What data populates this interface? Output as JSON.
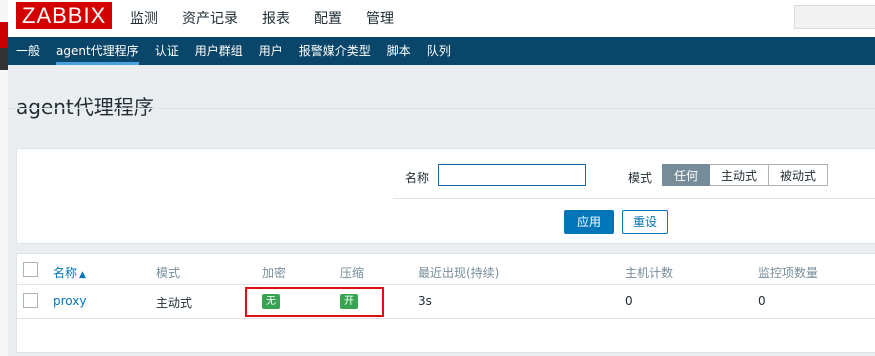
{
  "app": {
    "logo": "ZABBIX"
  },
  "top_menu": [
    "监测",
    "资产记录",
    "报表",
    "配置",
    "管理"
  ],
  "sub_menu": {
    "items": [
      "一般",
      "agent代理程序",
      "认证",
      "用户群组",
      "用户",
      "报警媒介类型",
      "脚本",
      "队列"
    ],
    "active": "agent代理程序"
  },
  "page": {
    "title": "agent代理程序"
  },
  "filter": {
    "name_label": "名称",
    "name_value": "",
    "mode_label": "模式",
    "mode_options": [
      "任何",
      "主动式",
      "被动式"
    ],
    "mode_selected": "任何",
    "apply_label": "应用",
    "reset_label": "重设"
  },
  "table": {
    "headers": {
      "name": "名称",
      "mode": "模式",
      "encryption": "加密",
      "compression": "压缩",
      "last_seen": "最近出现(持续)",
      "host_count": "主机计数",
      "item_count": "监控项数量"
    },
    "sort_indicator": "▲",
    "rows": [
      {
        "name": "proxy",
        "mode": "主动式",
        "encryption": "无",
        "compression": "开",
        "last_seen": "3s",
        "host_count": "0",
        "item_count": "0"
      }
    ]
  },
  "colors": {
    "brand": "#d40000",
    "nav": "#0a466a",
    "accent": "#0275b8",
    "badge": "#37a452",
    "highlight": "#e01010"
  }
}
